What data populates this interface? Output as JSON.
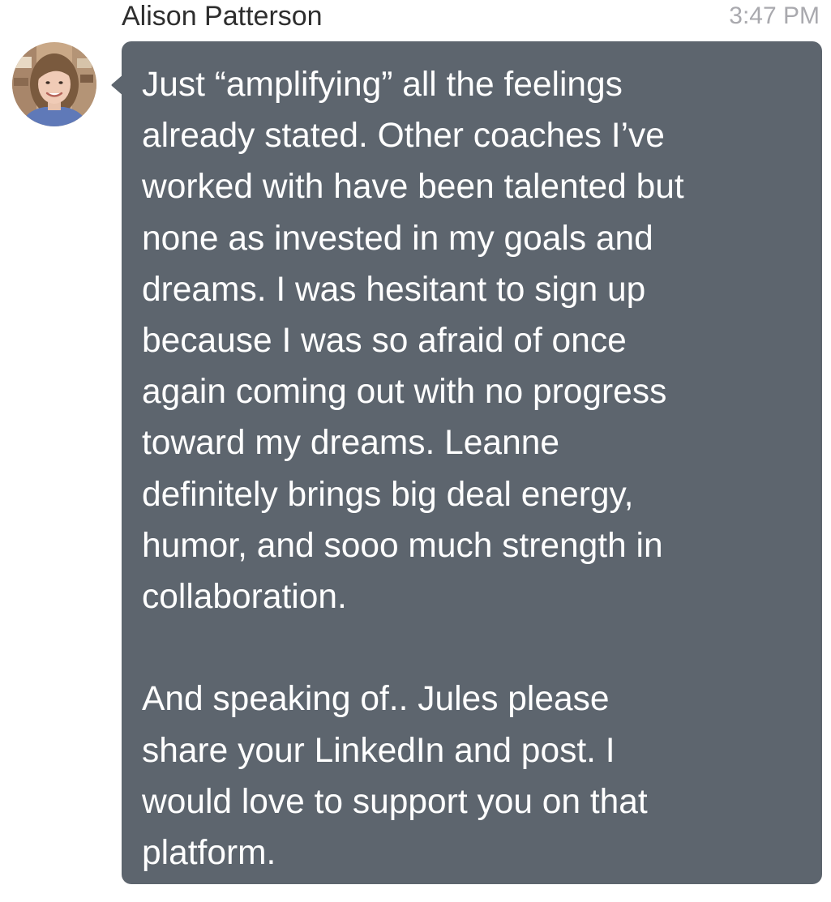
{
  "message": {
    "sender_name": "Alison Patterson",
    "timestamp": "3:47 PM",
    "avatar": "user-avatar-photo",
    "paragraphs": [
      "Just “amplifying” all the feelings\nalready stated. Other coaches I’ve\nworked with have been talented but\nnone as invested in my goals and\ndreams. I was hesitant to sign up\nbecause I was so afraid of once\nagain coming out with no progress\ntoward my dreams. Leanne\ndefinitely brings big deal energy,\nhumor, and sooo much strength in\ncollaboration.",
      "And speaking of.. Jules please\nshare your LinkedIn and post. I\nwould love to support you on that\nplatform."
    ]
  },
  "colors": {
    "bubble_background": "#5d656e",
    "bubble_text": "#ffffff",
    "sender_name": "#2e2e2e",
    "timestamp": "#a9a9ae",
    "page_background": "#ffffff"
  }
}
